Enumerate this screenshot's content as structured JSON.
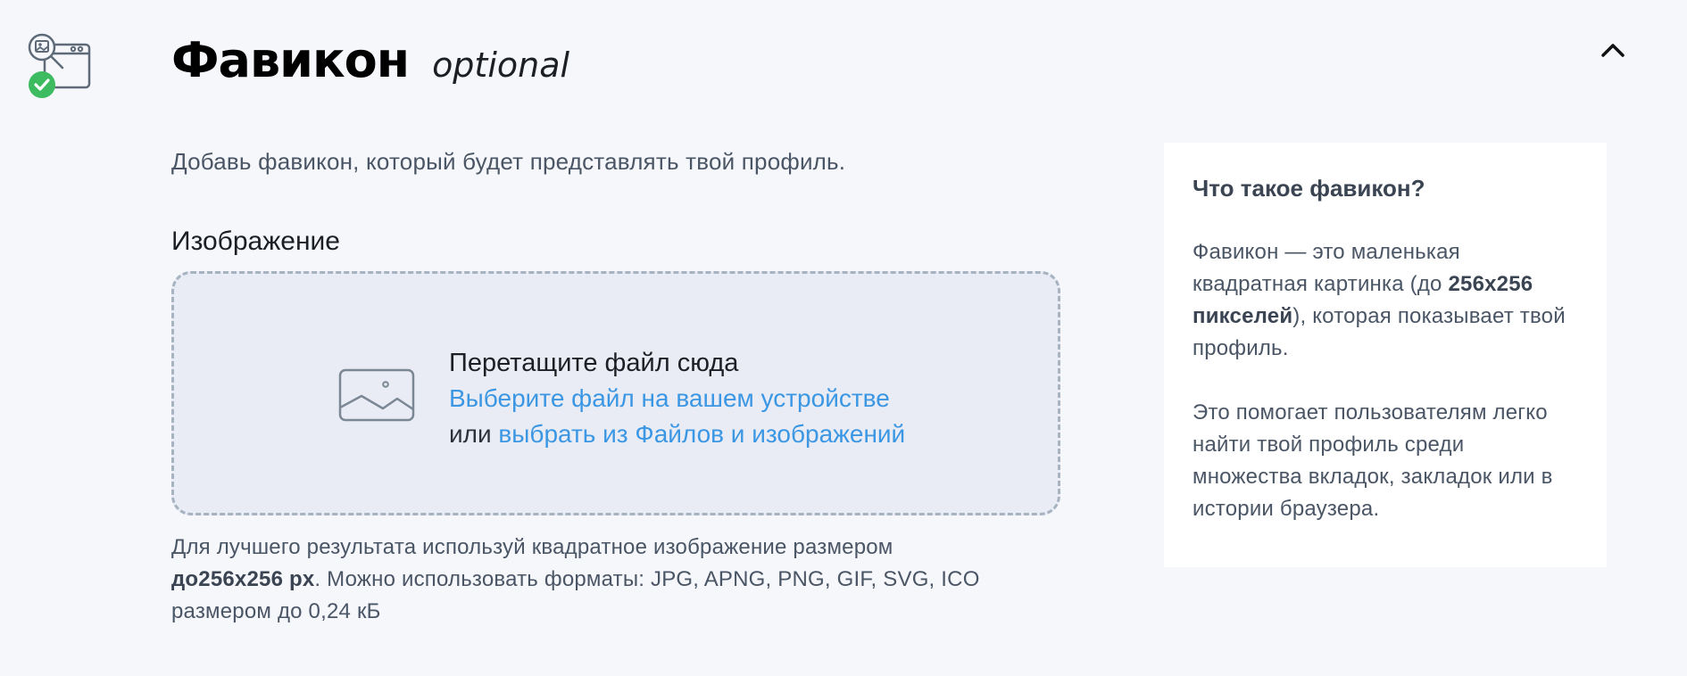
{
  "header": {
    "title": "Фавикон",
    "optional_label": "optional",
    "section_icon": "favicon-check-icon",
    "collapse_icon": "chevron-up-icon"
  },
  "description": "Добавь фавикон, который будет представлять твой профиль.",
  "field": {
    "label": "Изображение"
  },
  "dropzone": {
    "icon": "image-placeholder-icon",
    "title": "Перетащите файл сюда",
    "device_link": "Выберите файл на вашем устройстве",
    "or_text": "или",
    "files_link": "выбрать из Файлов и изображений"
  },
  "hint": {
    "part1": "Для лучшего результата используй квадратное изображение размером",
    "bold": "до256x256 px",
    "part2": ". Можно использовать форматы: JPG, APNG, PNG, GIF, SVG, ICO",
    "part3": "размером до 0,24 кБ"
  },
  "info": {
    "title": "Что такое фавикон?",
    "para1_start": "Фавикон — это маленькая квадратная картинка (до ",
    "para1_bold": "256x256 пикселей",
    "para1_end": "), которая показывает твой профиль.",
    "para2": "Это помогает пользователям легко найти твой профиль среди множества вкладок, закладок или в истории браузера."
  },
  "colors": {
    "background": "#f5f7fb",
    "link": "#3b97e3",
    "success": "#3dbb61",
    "dropzone_bg": "#e9ecf4",
    "dropzone_border": "#a7b3c1"
  }
}
